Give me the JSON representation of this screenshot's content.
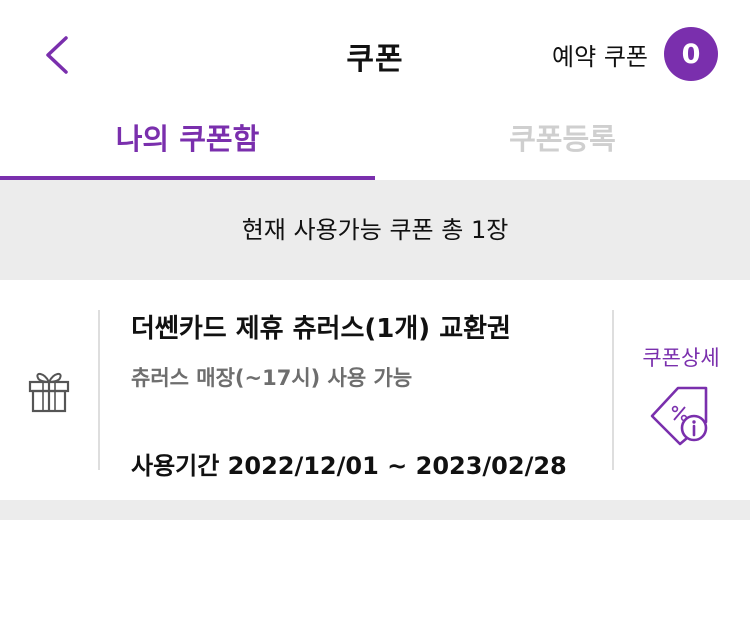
{
  "header": {
    "title": "쿠폰",
    "reserve_label": "예약 쿠폰",
    "reserve_count": "0"
  },
  "tabs": [
    {
      "label": "나의 쿠폰함",
      "active": true
    },
    {
      "label": "쿠폰등록",
      "active": false
    }
  ],
  "summary": "현재 사용가능 쿠폰 총 1장",
  "coupons": [
    {
      "name": "더쎈카드 제휴 츄러스(1개) 교환권",
      "desc": "츄러스 매장(~17시) 사용 가능",
      "period": "사용기간 2022/12/01 ~ 2023/02/28",
      "detail_label": "쿠폰상세"
    }
  ],
  "colors": {
    "accent": "#7a2fad",
    "inactive_tab": "#cfcfcf",
    "band": "#ececec"
  }
}
